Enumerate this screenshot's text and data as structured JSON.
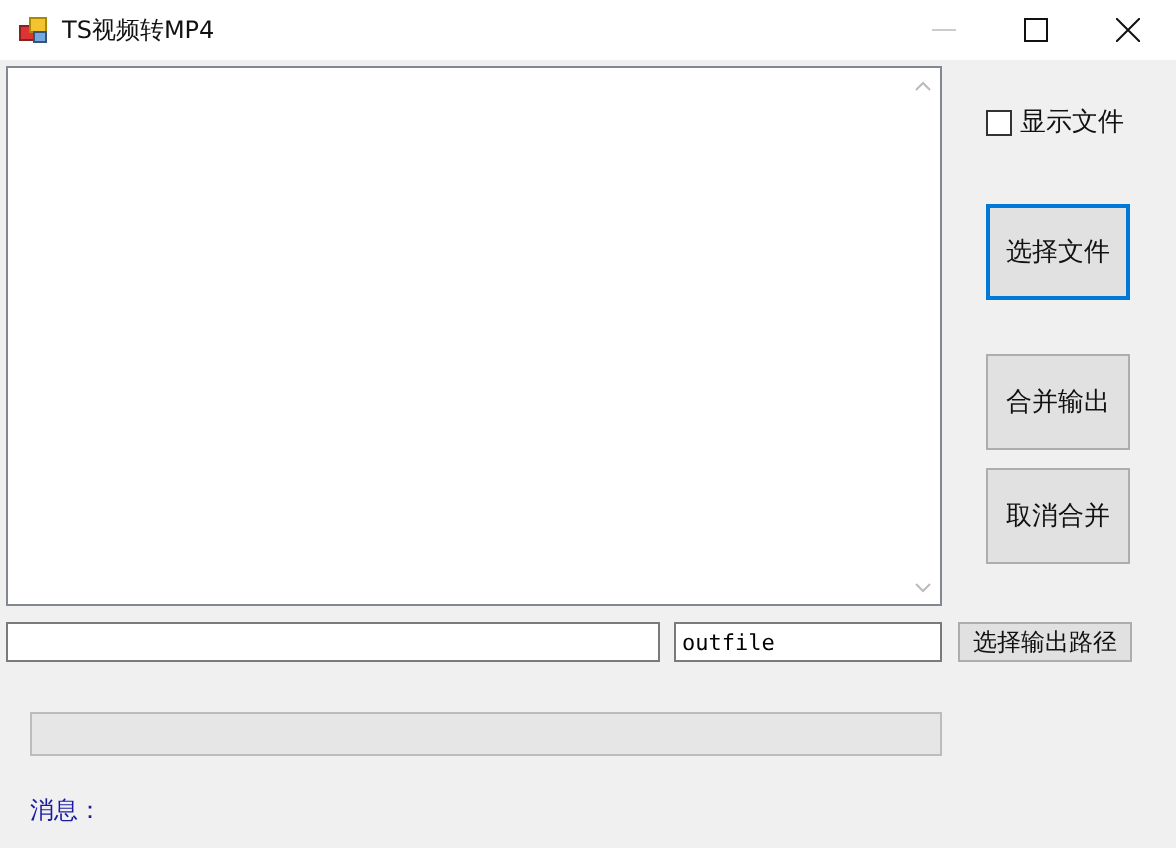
{
  "window": {
    "title": "TS视频转MP4"
  },
  "show_files": {
    "label": "显示文件",
    "checked": false
  },
  "buttons": [
    {
      "label": "选择文件",
      "focused": true
    },
    {
      "label": "合并输出",
      "focused": false
    },
    {
      "label": "取消合并",
      "focused": false
    }
  ],
  "output_name": {
    "value": "outfile"
  },
  "output_button": {
    "label": "选择输出路径"
  },
  "progress": {
    "level": 0
  },
  "message": {
    "label": "消息："
  }
}
